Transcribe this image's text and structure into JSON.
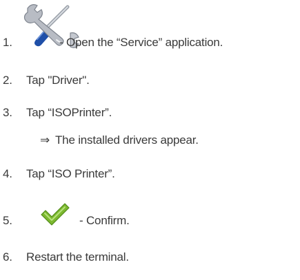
{
  "steps": [
    {
      "number": "1.",
      "text": "- Open the “Service” application.",
      "icon": "service-tools-icon"
    },
    {
      "number": "2.",
      "text": "Tap \"Driver\"."
    },
    {
      "number": "3.",
      "text": "Tap “ISOPrinter”.",
      "result": {
        "arrow": "⇒",
        "text": "The installed drivers appear."
      }
    },
    {
      "number": "4.",
      "text": "Tap “ISO Printer”."
    },
    {
      "number": "5.",
      "text": "- Confirm.",
      "icon": "confirm-checkmark-icon"
    },
    {
      "number": "6.",
      "text": "Restart the terminal."
    }
  ],
  "colors": {
    "text": "#3a3a3a",
    "wrench_blue": "#1f4fa8",
    "tool_silver": "#b8bcc4",
    "check_green": "#7cb82f"
  }
}
